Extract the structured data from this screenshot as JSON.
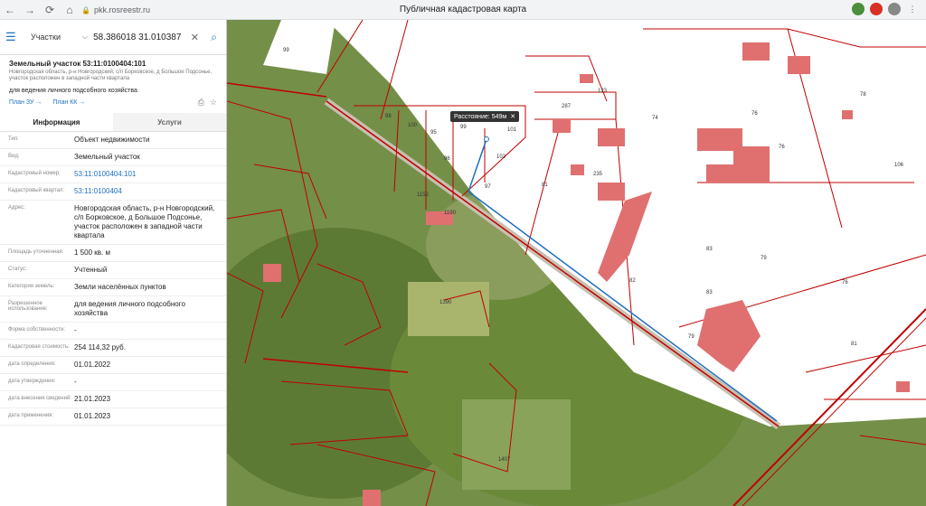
{
  "browser": {
    "url": "pkk.rosreestr.ru",
    "title": "Публичная кадастровая карта"
  },
  "search": {
    "type": "Участки",
    "value": "58.386018 31.010387"
  },
  "object": {
    "title": "Земельный участок 53:11:0100404:101",
    "address_small": "Новгородская область, р-н Новгородский, с/п Борковское, д Большое Подсонье, участок расположен в западной части квартала",
    "purpose": "для ведения личного подсобного хозяйства",
    "link_plan_zu": "План ЗУ →",
    "link_plan_kk": "План КК →"
  },
  "tabs": [
    "Информация",
    "Услуги"
  ],
  "info": [
    {
      "k": "Тип:",
      "v": "Объект недвижимости"
    },
    {
      "k": "Вид:",
      "v": "Земельный участок"
    },
    {
      "k": "Кадастровый номер:",
      "v": "53:11:0100404:101"
    },
    {
      "k": "Кадастровый квартал:",
      "v": "53:11:0100404"
    },
    {
      "k": "Адрес:",
      "v": "Новгородская область, р-н Новгородский, с/п Борковское, д Большое Подсонье, участок расположен в западной части квартала"
    },
    {
      "k": "Площадь уточненная:",
      "v": "1 500 кв. м"
    },
    {
      "k": "Статус:",
      "v": "Учтенный"
    },
    {
      "k": "Категория земель:",
      "v": "Земли населённых пунктов"
    },
    {
      "k": "Разрешенное использование:",
      "v": "для ведения личного подсобного хозяйства"
    },
    {
      "k": "Форма собственности:",
      "v": "-"
    },
    {
      "k": "Кадастровая стоимость:",
      "v": "254 114,32 руб."
    },
    {
      "k": "дата определения:",
      "v": "01.01.2022"
    },
    {
      "k": "дата утверждения:",
      "v": "-"
    },
    {
      "k": "дата внесения сведений:",
      "v": "21.01.2023"
    },
    {
      "k": "дата применения:",
      "v": "01.01.2023"
    }
  ],
  "map": {
    "distance": "Расстояние: 549м",
    "parcel_labels": [
      "99",
      "98",
      "100",
      "95",
      "99",
      "101",
      "102",
      "96",
      "97",
      "81",
      "287",
      "74",
      "78",
      "76",
      "76",
      "106",
      "83",
      "83",
      "79",
      "76",
      "79",
      "81",
      "82",
      "1152",
      "1190",
      "1390",
      "1407",
      "123",
      "235"
    ]
  },
  "colors": {
    "accent": "#1e6fbf",
    "parcel_line": "#c00000",
    "building": "#e07070"
  }
}
